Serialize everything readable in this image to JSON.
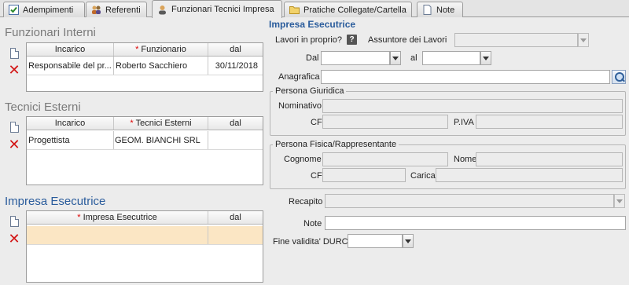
{
  "tabs": [
    {
      "label": "Adempimenti",
      "icon": "checkbox-icon"
    },
    {
      "label": "Referenti",
      "icon": "people-icon"
    },
    {
      "label": "Funzionari Tecnici Impresa",
      "icon": "person-icon"
    },
    {
      "label": "Pratiche Collegate/Cartella",
      "icon": "folder-icon"
    },
    {
      "label": "Note",
      "icon": "note-icon"
    }
  ],
  "funzionari": {
    "title": "Funzionari Interni",
    "headers": [
      "Incarico",
      "Funzionario",
      "dal"
    ],
    "rows": [
      {
        "incarico": "Responsabile del pr...",
        "nome": "Roberto Sacchiero",
        "dal": "30/11/2018"
      }
    ]
  },
  "tecnici": {
    "title": "Tecnici Esterni",
    "headers": [
      "Incarico",
      "Tecnici Esterni",
      "dal"
    ],
    "rows": [
      {
        "incarico": "Progettista",
        "nome": "GEOM. BIANCHI SRL",
        "dal": ""
      }
    ]
  },
  "impresa_list": {
    "title": "Impresa Esecutrice",
    "headers": [
      "Impresa Esecutrice",
      "dal"
    ]
  },
  "form": {
    "title": "Impresa Esecutrice",
    "lavori_label": "Lavori in proprio?",
    "help_symbol": "?",
    "assuntore_label": "Assuntore dei Lavori",
    "dal_label": "Dal",
    "al_label": "al",
    "anagrafica_label": "Anagrafica",
    "giuridica": {
      "legend": "Persona Giuridica",
      "nominativo": "Nominativo",
      "cf": "CF",
      "piva": "P.IVA"
    },
    "fisica": {
      "legend": "Persona Fisica/Rappresentante",
      "cognome": "Cognome",
      "nome": "Nome",
      "cf": "CF",
      "carica": "Carica"
    },
    "recapito_label": "Recapito",
    "note_label": "Note",
    "durc_label": "Fine validita' DURC"
  },
  "required_mark": "*"
}
